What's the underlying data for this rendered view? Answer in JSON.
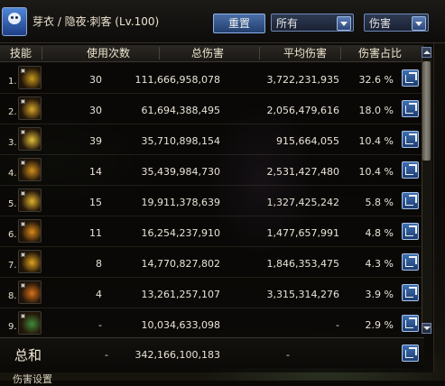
{
  "title": "芽衣 / 隐夜·刺客 (Lv.100)",
  "controls": {
    "reset_label": "重置",
    "filter_select": "所有",
    "type_select": "伤害"
  },
  "table": {
    "headers": [
      "技能",
      "使用次数",
      "总伤害",
      "平均伤害",
      "伤害占比"
    ],
    "rows": [
      {
        "index": "1.",
        "count": "30",
        "total": "111,666,958,078",
        "avg": "3,722,231,935",
        "pct": "32.6 %",
        "icon_name": "skill-icon-golden-slash",
        "icon_color": "#c79a1f"
      },
      {
        "index": "2.",
        "count": "30",
        "total": "61,694,388,495",
        "avg": "2,056,479,616",
        "pct": "18.0 %",
        "icon_name": "skill-icon-twin-blades",
        "icon_color": "#d8a52b"
      },
      {
        "index": "3.",
        "count": "39",
        "total": "35,710,898,154",
        "avg": "915,664,055",
        "pct": "10.4 %",
        "icon_name": "skill-icon-lightning",
        "icon_color": "#e3c03b"
      },
      {
        "index": "4.",
        "count": "14",
        "total": "35,439,984,730",
        "avg": "2,531,427,480",
        "pct": "10.4 %",
        "icon_name": "skill-icon-orb-burst",
        "icon_color": "#d38f1d"
      },
      {
        "index": "5.",
        "count": "15",
        "total": "19,911,378,639",
        "avg": "1,327,425,242",
        "pct": "5.8 %",
        "icon_name": "skill-icon-spark-rain",
        "icon_color": "#e0b12f"
      },
      {
        "index": "6.",
        "count": "11",
        "total": "16,254,237,910",
        "avg": "1,477,657,991",
        "pct": "4.8 %",
        "icon_name": "skill-icon-flame-wave",
        "icon_color": "#d9891a"
      },
      {
        "index": "7.",
        "count": "8",
        "total": "14,770,827,802",
        "avg": "1,846,353,475",
        "pct": "4.3 %",
        "icon_name": "skill-icon-blade-storm",
        "icon_color": "#e0a21f"
      },
      {
        "index": "8.",
        "count": "4",
        "total": "13,261,257,107",
        "avg": "3,315,314,276",
        "pct": "3.9 %",
        "icon_name": "skill-icon-fire-sweep",
        "icon_color": "#d9701a"
      },
      {
        "index": "9.",
        "count": "-",
        "total": "10,034,633,098",
        "avg": "-",
        "pct": "2.9 %",
        "icon_name": "skill-icon-green-vortex",
        "icon_color": "#3f8a3a"
      }
    ]
  },
  "summary": {
    "label": "总和",
    "count": "-",
    "total": "342,166,100,183",
    "avg": "-"
  },
  "bottom_text": "伤害设置"
}
